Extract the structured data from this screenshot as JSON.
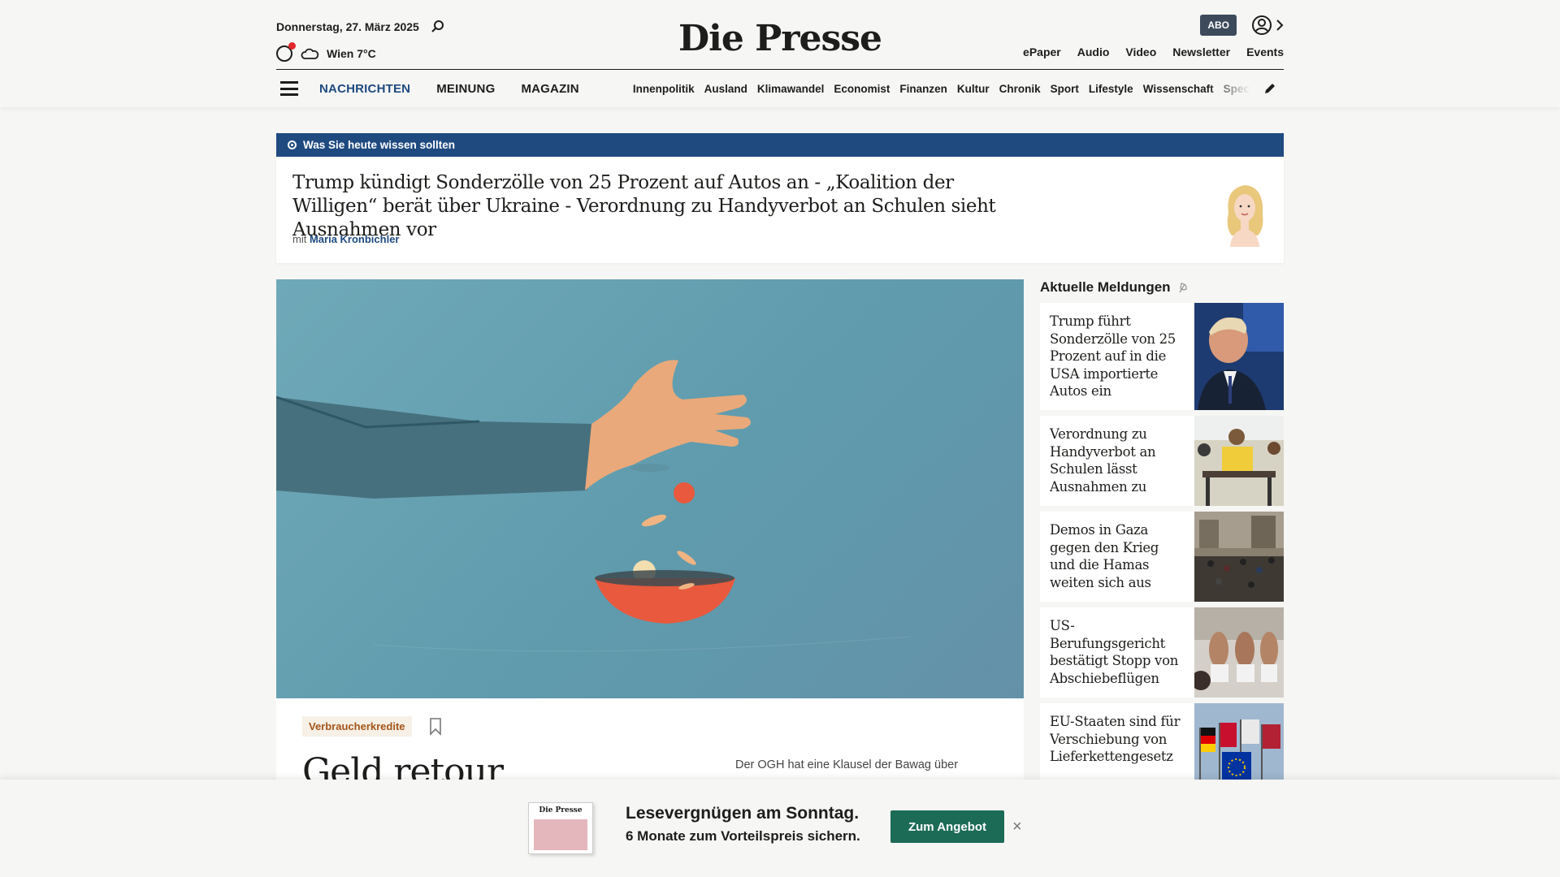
{
  "header": {
    "date": "Donnerstag, 27. März 2025",
    "weather": "Wien 7°C",
    "logo": "Die Presse",
    "abo": "ABO",
    "services": [
      "ePaper",
      "Audio",
      "Video",
      "Newsletter",
      "Events"
    ]
  },
  "nav": {
    "main": [
      "NACHRICHTEN",
      "MEINUNG",
      "MAGAZIN"
    ],
    "sections": [
      "Innenpolitik",
      "Ausland",
      "Klimawandel",
      "Economist",
      "Finanzen",
      "Kultur",
      "Chronik",
      "Sport",
      "Lifestyle",
      "Wissenschaft",
      "Spectrum"
    ]
  },
  "briefing": {
    "label": "Was Sie heute wissen sollten",
    "title": "Trump kündigt Sonderzölle von 25 Prozent auf Autos an - „Koalition der Willigen“ berät über Ukraine - Verordnung zu Handyverbot an Schulen sieht Ausnahmen vor",
    "author_prefix": "mit",
    "author": "Maria Kronbichler"
  },
  "hero": {
    "tag": "Verbraucherkredite",
    "title": "Geld retour",
    "teaser": "Der OGH hat eine Klausel der Bawag über"
  },
  "aside": {
    "heading": "Aktuelle Meldungen",
    "items": [
      {
        "title": "Trump führt Sonderzölle von 25 Prozent auf in die USA importierte Autos ein"
      },
      {
        "title": "Verordnung zu Handyverbot an Schulen lässt Ausnahmen zu"
      },
      {
        "title": "Demos in Gaza gegen den Krieg und die Hamas weiten sich aus"
      },
      {
        "title": "US-Berufungsgericht bestätigt Stopp von Abschiebeflügen"
      },
      {
        "title": "EU-Staaten sind für Verschiebung von Lieferkettengesetz"
      }
    ]
  },
  "promo": {
    "magazine_logo": "Die Presse",
    "line1": "Lesevergnügen am Sonntag.",
    "line2": "6 Monate zum Vorteilspreis sichern.",
    "button": "Zum Angebot",
    "close": "×"
  },
  "colors": {
    "brand_blue": "#1f4a80",
    "promo_green": "#1c6b57",
    "tag_orange": "#a5541a",
    "hero_bg": "#6fa9b8"
  }
}
